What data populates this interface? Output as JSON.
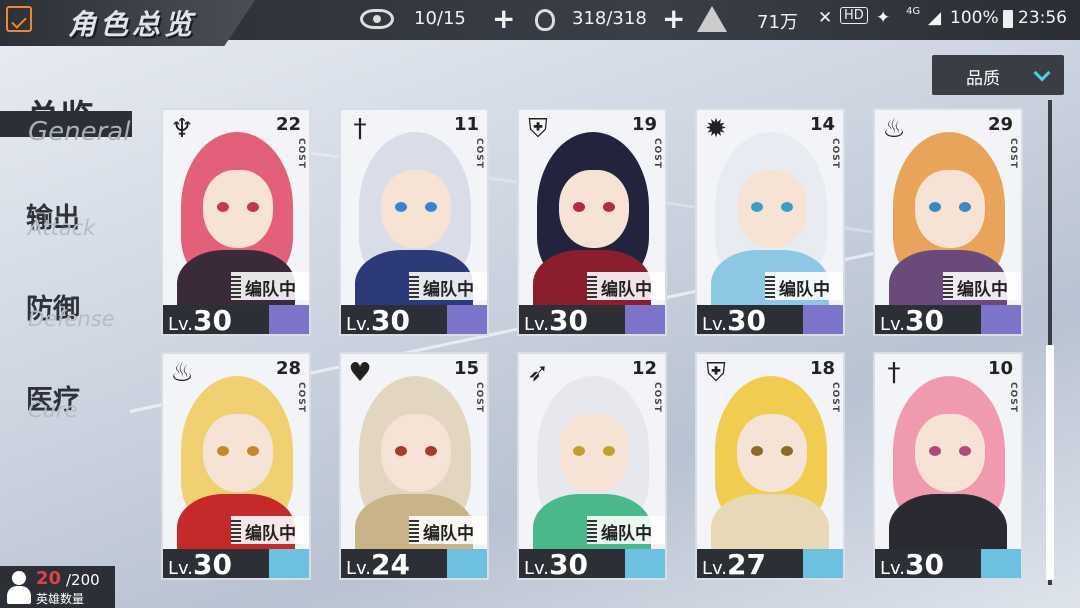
{
  "header": {
    "title": "角色总览",
    "stamina": "10/15",
    "energy": "318/318",
    "currency": "71万"
  },
  "status_bar": {
    "hd": "HD",
    "network": "4G",
    "battery": "100%",
    "time": "23:56"
  },
  "filter": {
    "label": "品质"
  },
  "categories": [
    {
      "cn": "总览",
      "en": "General"
    },
    {
      "cn": "输出",
      "en": "Attack"
    },
    {
      "cn": "防御",
      "en": "Defense"
    },
    {
      "cn": "医疗",
      "en": "Cure"
    }
  ],
  "cards": [
    {
      "cost": "22",
      "cost_label": "COST",
      "team": "编队中",
      "lv_prefix": "Lv.",
      "level": "30",
      "class_icon": "demon-icon",
      "hair": "#e2607a",
      "body": "#3b2a3a",
      "eyes": "#c23a4a",
      "stripe": "#7c74c8"
    },
    {
      "cost": "11",
      "cost_label": "COST",
      "team": "编队中",
      "lv_prefix": "Lv.",
      "level": "30",
      "class_icon": "sword-icon",
      "hair": "#d8dde8",
      "body": "#2d3a78",
      "eyes": "#3b83c9",
      "stripe": "#7c74c8"
    },
    {
      "cost": "19",
      "cost_label": "COST",
      "team": "编队中",
      "lv_prefix": "Lv.",
      "level": "30",
      "class_icon": "shield-icon",
      "hair": "#24233d",
      "body": "#8a1e2f",
      "eyes": "#b02a4a",
      "stripe": "#7c74c8"
    },
    {
      "cost": "14",
      "cost_label": "COST",
      "team": "编队中",
      "lv_prefix": "Lv.",
      "level": "30",
      "class_icon": "star-burst-icon",
      "hair": "#e8ecf2",
      "body": "#8cc8e4",
      "eyes": "#3aa0c0",
      "stripe": "#7c74c8"
    },
    {
      "cost": "29",
      "cost_label": "COST",
      "team": "编队中",
      "lv_prefix": "Lv.",
      "level": "30",
      "class_icon": "fire-icon",
      "hair": "#e8a45a",
      "body": "#6a4a7a",
      "eyes": "#3a8ac0",
      "stripe": "#7c74c8"
    },
    {
      "cost": "28",
      "cost_label": "COST",
      "team": "编队中",
      "lv_prefix": "Lv.",
      "level": "30",
      "class_icon": "fire-icon",
      "hair": "#f0d070",
      "body": "#c42a2a",
      "eyes": "#c08a2a",
      "stripe": "#6ec0e0"
    },
    {
      "cost": "15",
      "cost_label": "COST",
      "team": "编队中",
      "lv_prefix": "Lv.",
      "level": "24",
      "class_icon": "heart-icon",
      "hair": "#e2d6c0",
      "body": "#c9b48a",
      "eyes": "#a0402a",
      "stripe": "#6ec0e0"
    },
    {
      "cost": "12",
      "cost_label": "COST",
      "team": "编队中",
      "lv_prefix": "Lv.",
      "level": "30",
      "class_icon": "bow-icon",
      "hair": "#e6e8ee",
      "body": "#4ab88a",
      "eyes": "#c0a02a",
      "stripe": "#6ec0e0"
    },
    {
      "cost": "18",
      "cost_label": "COST",
      "team": "",
      "lv_prefix": "Lv.",
      "level": "27",
      "class_icon": "shield-icon",
      "hair": "#f0cc50",
      "body": "#e8d8b8",
      "eyes": "#8a6a2a",
      "stripe": "#6ec0e0"
    },
    {
      "cost": "10",
      "cost_label": "COST",
      "team": "",
      "lv_prefix": "Lv.",
      "level": "30",
      "class_icon": "sword-icon",
      "hair": "#f09ab0",
      "body": "#2a2a32",
      "eyes": "#b04a7a",
      "stripe": "#6ec0e0"
    }
  ],
  "hero_count": {
    "current": "20",
    "max": "/200",
    "label": "英雄数量"
  }
}
